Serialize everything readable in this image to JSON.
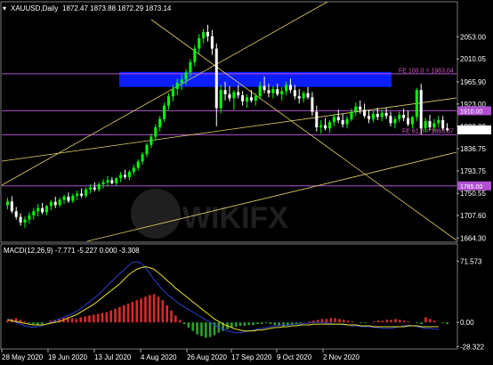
{
  "chart_data": {
    "type": "candlestick",
    "symbol_label": "XAUUSD,Daily",
    "ohlc_label": "1872.47 1873.88 1872.29 1873.14",
    "y_ticks": [
      "2053.00",
      "2010.05",
      "1965.90",
      "1923.00",
      "1880.00",
      "1836.75",
      "1793.75",
      "1750.55",
      "1707.60",
      "1664.30"
    ],
    "ylim": [
      1658,
      2093
    ],
    "x_labels": [
      "28 May 2020",
      "19 Jun 2020",
      "13 Jul 2020",
      "4 Aug 2020",
      "26 Aug 2020",
      "17 Sep 2020",
      "9 Oct 2020",
      "2 Nov 2020"
    ],
    "candles": [
      [
        1728,
        1742,
        1720,
        1735
      ],
      [
        1735,
        1745,
        1712,
        1716
      ],
      [
        1716,
        1724,
        1700,
        1705
      ],
      [
        1705,
        1712,
        1688,
        1694
      ],
      [
        1694,
        1706,
        1684,
        1700
      ],
      [
        1700,
        1714,
        1692,
        1708
      ],
      [
        1708,
        1722,
        1700,
        1716
      ],
      [
        1716,
        1730,
        1706,
        1722
      ],
      [
        1722,
        1732,
        1710,
        1714
      ],
      [
        1714,
        1728,
        1708,
        1726
      ],
      [
        1726,
        1738,
        1718,
        1734
      ],
      [
        1734,
        1744,
        1722,
        1728
      ],
      [
        1728,
        1742,
        1724,
        1738
      ],
      [
        1738,
        1748,
        1730,
        1744
      ],
      [
        1744,
        1752,
        1732,
        1736
      ],
      [
        1736,
        1750,
        1732,
        1746
      ],
      [
        1746,
        1756,
        1738,
        1750
      ],
      [
        1750,
        1760,
        1742,
        1746
      ],
      [
        1746,
        1762,
        1742,
        1758
      ],
      [
        1758,
        1768,
        1750,
        1762
      ],
      [
        1762,
        1772,
        1754,
        1758
      ],
      [
        1758,
        1772,
        1754,
        1768
      ],
      [
        1768,
        1778,
        1760,
        1772
      ],
      [
        1772,
        1784,
        1764,
        1776
      ],
      [
        1776,
        1782,
        1768,
        1770
      ],
      [
        1770,
        1782,
        1766,
        1780
      ],
      [
        1780,
        1792,
        1772,
        1786
      ],
      [
        1786,
        1796,
        1778,
        1782
      ],
      [
        1782,
        1796,
        1776,
        1792
      ],
      [
        1792,
        1806,
        1786,
        1800
      ],
      [
        1800,
        1816,
        1794,
        1812
      ],
      [
        1812,
        1830,
        1806,
        1826
      ],
      [
        1826,
        1848,
        1820,
        1844
      ],
      [
        1844,
        1866,
        1838,
        1860
      ],
      [
        1860,
        1884,
        1852,
        1878
      ],
      [
        1878,
        1900,
        1870,
        1894
      ],
      [
        1894,
        1926,
        1888,
        1920
      ],
      [
        1920,
        1944,
        1912,
        1938
      ],
      [
        1938,
        1960,
        1928,
        1952
      ],
      [
        1952,
        1972,
        1940,
        1964
      ],
      [
        1964,
        1980,
        1950,
        1970
      ],
      [
        1970,
        1990,
        1960,
        1984
      ],
      [
        1984,
        2010,
        1976,
        2004
      ],
      [
        2004,
        2036,
        1996,
        2030
      ],
      [
        2030,
        2058,
        2020,
        2050
      ],
      [
        2050,
        2068,
        2040,
        2062
      ],
      [
        2062,
        2076,
        2044,
        2054
      ],
      [
        2054,
        2066,
        2018,
        2030
      ],
      [
        2030,
        2040,
        1880,
        1915
      ],
      [
        1915,
        1960,
        1905,
        1950
      ],
      [
        1950,
        1966,
        1930,
        1942
      ],
      [
        1942,
        1958,
        1928,
        1934
      ],
      [
        1934,
        1950,
        1912,
        1946
      ],
      [
        1946,
        1960,
        1934,
        1940
      ],
      [
        1940,
        1948,
        1920,
        1928
      ],
      [
        1928,
        1942,
        1916,
        1936
      ],
      [
        1936,
        1950,
        1926,
        1930
      ],
      [
        1930,
        1944,
        1920,
        1938
      ],
      [
        1938,
        1966,
        1932,
        1958
      ],
      [
        1958,
        1976,
        1944,
        1950
      ],
      [
        1950,
        1962,
        1936,
        1944
      ],
      [
        1944,
        1958,
        1934,
        1952
      ],
      [
        1952,
        1962,
        1938,
        1942
      ],
      [
        1942,
        1956,
        1930,
        1948
      ],
      [
        1948,
        1966,
        1940,
        1960
      ],
      [
        1960,
        1972,
        1944,
        1950
      ],
      [
        1950,
        1960,
        1932,
        1938
      ],
      [
        1938,
        1952,
        1924,
        1934
      ],
      [
        1934,
        1948,
        1926,
        1944
      ],
      [
        1944,
        1956,
        1932,
        1936
      ],
      [
        1936,
        1946,
        1900,
        1908
      ],
      [
        1908,
        1920,
        1870,
        1878
      ],
      [
        1878,
        1892,
        1866,
        1882
      ],
      [
        1882,
        1896,
        1872,
        1876
      ],
      [
        1876,
        1892,
        1868,
        1888
      ],
      [
        1888,
        1904,
        1880,
        1898
      ],
      [
        1898,
        1912,
        1886,
        1892
      ],
      [
        1892,
        1904,
        1878,
        1884
      ],
      [
        1884,
        1900,
        1876,
        1894
      ],
      [
        1894,
        1914,
        1890,
        1908
      ],
      [
        1908,
        1926,
        1900,
        1918
      ],
      [
        1918,
        1930,
        1904,
        1912
      ],
      [
        1912,
        1924,
        1896,
        1900
      ],
      [
        1900,
        1912,
        1886,
        1894
      ],
      [
        1894,
        1910,
        1888,
        1904
      ],
      [
        1904,
        1916,
        1892,
        1898
      ],
      [
        1898,
        1912,
        1890,
        1906
      ],
      [
        1906,
        1916,
        1894,
        1900
      ],
      [
        1900,
        1908,
        1880,
        1886
      ],
      [
        1886,
        1900,
        1876,
        1894
      ],
      [
        1894,
        1908,
        1888,
        1902
      ],
      [
        1902,
        1914,
        1890,
        1896
      ],
      [
        1896,
        1910,
        1880,
        1884
      ],
      [
        1884,
        1900,
        1876,
        1898
      ],
      [
        1898,
        1954,
        1890,
        1950
      ],
      [
        1950,
        1962,
        1864,
        1876
      ],
      [
        1876,
        1896,
        1868,
        1890
      ],
      [
        1890,
        1902,
        1872,
        1878
      ],
      [
        1878,
        1894,
        1870,
        1886
      ],
      [
        1886,
        1900,
        1878,
        1892
      ],
      [
        1892,
        1900,
        1872,
        1876
      ],
      [
        1876,
        1886,
        1870,
        1873
      ]
    ],
    "overlays": {
      "fe_100_label": "FE 100.0 = 1983.04",
      "fe_618_label": "FE 61.8 = 1863.67",
      "level_1910_label": "1910.00",
      "level_1765_label": "1765.00",
      "last_price_label": "1873.14",
      "zone_top": 1985,
      "zone_bottom": 1956,
      "level_1910": 1910,
      "fe_618": 1863.67,
      "level_1765": 1765,
      "last_price": 1873.14
    },
    "macd": {
      "label": "MACD(12,26,9) -7.771 -5.227 0.000 -3.308",
      "y_ticks": [
        "71.573",
        "0.00",
        "-28.322"
      ],
      "ylim": [
        -30,
        75
      ],
      "histogram": [
        2,
        4,
        5,
        3,
        1,
        -1,
        -2,
        -3,
        -2,
        0,
        2,
        3,
        4,
        5,
        6,
        5,
        4,
        6,
        7,
        8,
        9,
        10,
        11,
        12,
        14,
        16,
        18,
        20,
        22,
        24,
        26,
        28,
        30,
        32,
        33,
        30,
        26,
        20,
        14,
        8,
        3,
        -2,
        -6,
        -10,
        -14,
        -16,
        -18,
        -17,
        -15,
        -12,
        -10,
        -8,
        -6,
        -5,
        -4,
        -4,
        -3,
        -3,
        -2,
        -2,
        -1,
        -2,
        -3,
        -4,
        -5,
        -4,
        -3,
        -2,
        -1,
        0,
        1,
        2,
        3,
        4,
        4,
        5,
        5,
        4,
        3,
        2,
        1,
        0,
        -1,
        -1,
        0,
        1,
        2,
        2,
        3,
        3,
        4,
        3,
        2,
        1,
        0,
        -1,
        -2,
        6,
        4,
        2,
        0,
        -1,
        -2
      ],
      "macd_line": [
        4,
        2,
        0,
        -2,
        -4,
        -5,
        -6,
        -5,
        -4,
        -2,
        0,
        2,
        4,
        6,
        8,
        10,
        13,
        16,
        20,
        24,
        28,
        32,
        37,
        42,
        47,
        52,
        57,
        61,
        66,
        70,
        71,
        69,
        64,
        57,
        50,
        44,
        38,
        33,
        29,
        25,
        21,
        18,
        15,
        12,
        9,
        6,
        3,
        0,
        -3,
        -6,
        -8,
        -10,
        -11,
        -12,
        -12,
        -11,
        -10,
        -9,
        -8,
        -7,
        -6,
        -5,
        -4,
        -4,
        -3,
        -3,
        -2,
        -2,
        -2,
        -1,
        -1,
        0,
        0,
        0,
        -1,
        -1,
        -2,
        -2,
        -3,
        -3,
        -4,
        -4,
        -5,
        -5,
        -5,
        -6,
        -6,
        -7,
        -7,
        -7,
        -6,
        -5,
        -4,
        -3,
        -4,
        -5,
        -6,
        -7,
        -7,
        -8,
        -8
      ],
      "signal_line": [
        3,
        2,
        1,
        0,
        -1,
        -2,
        -3,
        -3,
        -3,
        -2,
        -1,
        0,
        1,
        3,
        5,
        7,
        9,
        12,
        15,
        18,
        21,
        25,
        29,
        33,
        37,
        41,
        45,
        50,
        55,
        59,
        62,
        64,
        65,
        64,
        62,
        58,
        54,
        49,
        45,
        40,
        36,
        32,
        28,
        24,
        20,
        16,
        12,
        8,
        4,
        1,
        -2,
        -4,
        -6,
        -8,
        -9,
        -10,
        -10,
        -10,
        -9,
        -9,
        -8,
        -7,
        -6,
        -6,
        -5,
        -5,
        -4,
        -4,
        -3,
        -3,
        -3,
        -2,
        -2,
        -2,
        -2,
        -2,
        -2,
        -2,
        -2,
        -3,
        -3,
        -3,
        -4,
        -4,
        -4,
        -5,
        -5,
        -5,
        -5,
        -5,
        -5,
        -5,
        -5,
        -4,
        -4,
        -4,
        -5,
        -5,
        -5,
        -5,
        -5
      ]
    },
    "colors": {
      "bull": "#00ff00",
      "bear": "#ffffff",
      "zone": "#0a1eff",
      "trend": "#e6d36a",
      "level": "#b04fd2",
      "fe_text": "#d55ac8",
      "hist_pos": "#d42a2a",
      "hist_neg": "#2e9c2e",
      "macd_line": "#2f3fcf",
      "signal_line": "#e8e22a"
    }
  }
}
